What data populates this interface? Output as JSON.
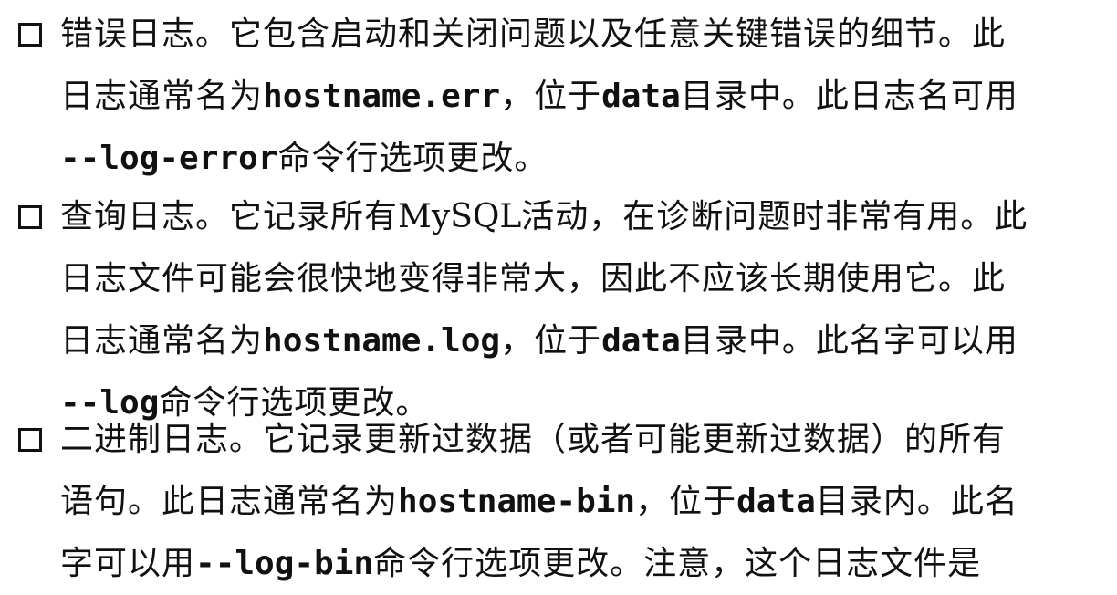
{
  "items": [
    {
      "lines": [
        [
          {
            "t": "text",
            "v": "错误日志。它包含启动和关闭问题以及任意关键错误的细节。此"
          }
        ],
        [
          {
            "t": "text",
            "v": "日志通常名为"
          },
          {
            "t": "mono",
            "v": "hostname.err"
          },
          {
            "t": "text",
            "v": "，位于"
          },
          {
            "t": "mono",
            "v": "data"
          },
          {
            "t": "text",
            "v": "目录中。此日志名可用"
          }
        ],
        [
          {
            "t": "mono",
            "v": "--log-error"
          },
          {
            "t": "text",
            "v": "命令行选项更改。"
          }
        ]
      ]
    },
    {
      "lines": [
        [
          {
            "t": "text",
            "v": "查询日志。它记录所有"
          },
          {
            "t": "latin",
            "v": "MySQL"
          },
          {
            "t": "text",
            "v": "活动，在诊断问题时非常有用。此"
          }
        ],
        [
          {
            "t": "text",
            "v": "日志文件可能会很快地变得非常大，因此不应该长期使用它。此"
          }
        ],
        [
          {
            "t": "text",
            "v": "日志通常名为"
          },
          {
            "t": "mono",
            "v": "hostname.log"
          },
          {
            "t": "text",
            "v": "，位于"
          },
          {
            "t": "mono",
            "v": "data"
          },
          {
            "t": "text",
            "v": "目录中。此名字可以用"
          }
        ],
        [
          {
            "t": "mono",
            "v": "--log"
          },
          {
            "t": "text",
            "v": "命令行选项更改。"
          }
        ]
      ]
    },
    {
      "lines": [
        [
          {
            "t": "text",
            "v": "二进制日志。它记录更新过数据（或者可能更新过数据）的所有"
          }
        ],
        [
          {
            "t": "text",
            "v": "语句。此日志通常名为"
          },
          {
            "t": "mono",
            "v": "hostname-bin"
          },
          {
            "t": "text",
            "v": "，位于"
          },
          {
            "t": "mono",
            "v": "data"
          },
          {
            "t": "text",
            "v": "目录内。此名"
          }
        ],
        [
          {
            "t": "text",
            "v": "字可以用"
          },
          {
            "t": "mono",
            "v": "--log-bin"
          },
          {
            "t": "text",
            "v": "命令行选项更改。注意，这个日志文件是"
          }
        ]
      ]
    }
  ]
}
